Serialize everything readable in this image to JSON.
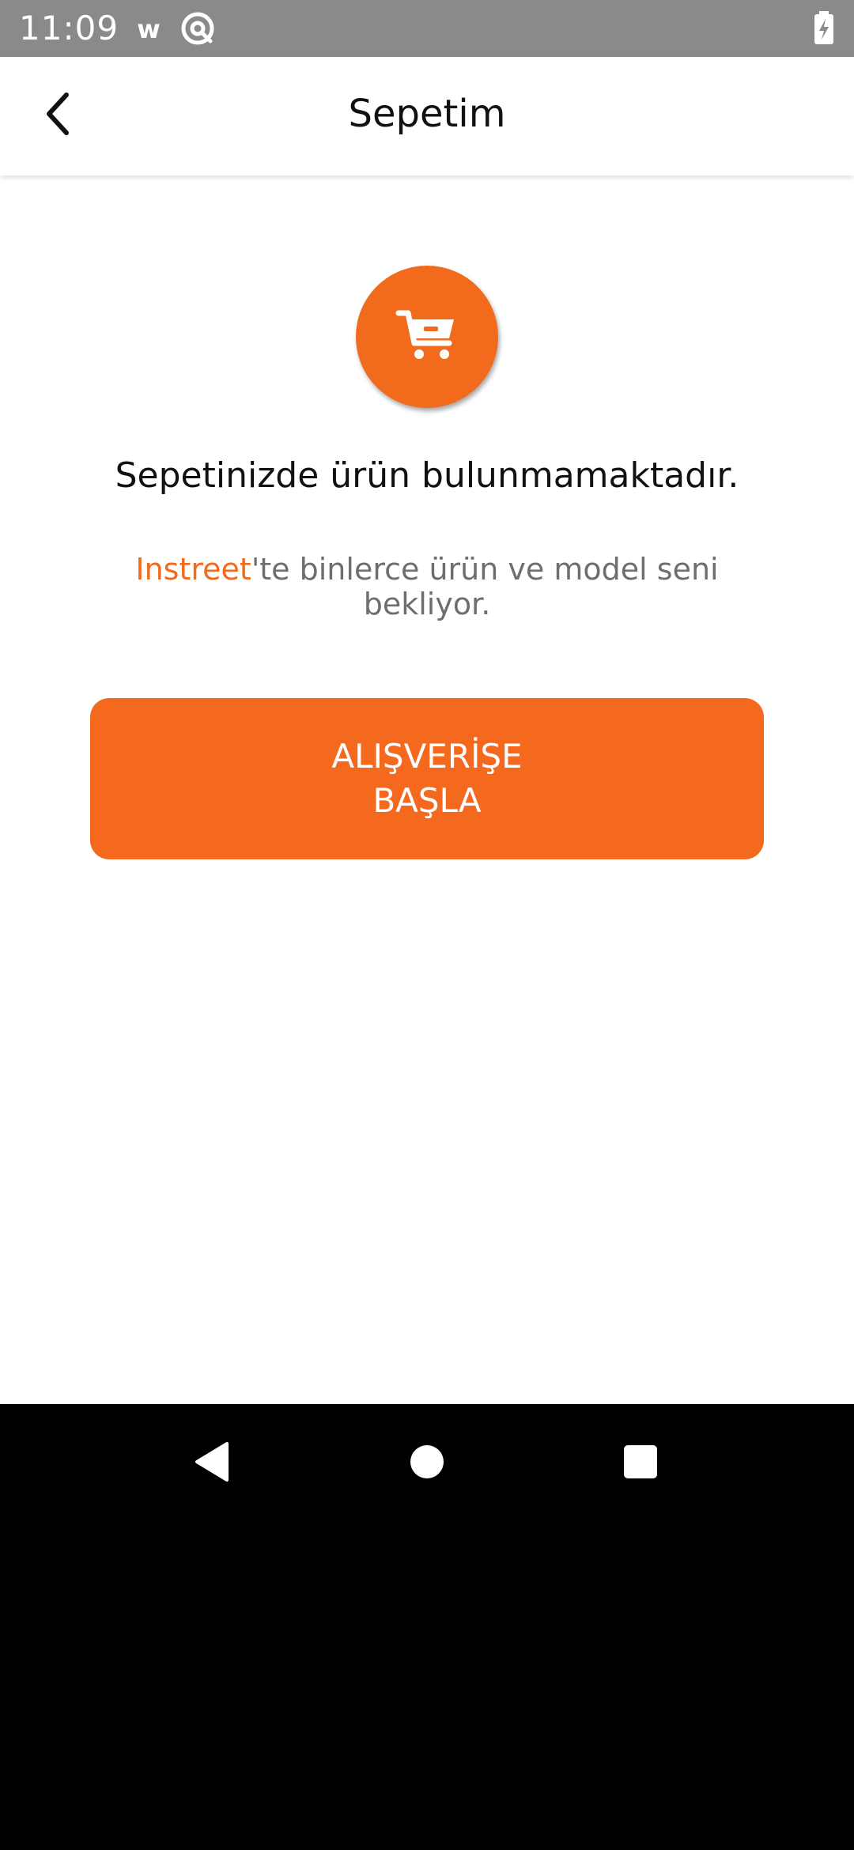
{
  "status_bar": {
    "time": "11:09",
    "icons": [
      "w-notification-icon",
      "at-sign-icon",
      "battery-charging-icon"
    ],
    "background": "#8a8a8a"
  },
  "header": {
    "title": "Sepetim",
    "back_icon": "chevron-left-icon"
  },
  "empty_state": {
    "icon": "shopping-cart-icon",
    "title": "Sepetinizde ürün bulunmamaktadır.",
    "brand": "Instreet",
    "subtitle_rest": "'te binlerce ürün ve model seni bekliyor.",
    "button_label": "ALIŞVERİŞE BAŞLA"
  },
  "nav_bar": {
    "icons": [
      "back-triangle-icon",
      "home-circle-icon",
      "recents-square-icon"
    ]
  },
  "colors": {
    "accent": "#f26a1b",
    "text": "#111111",
    "muted": "#6e6e6e"
  }
}
